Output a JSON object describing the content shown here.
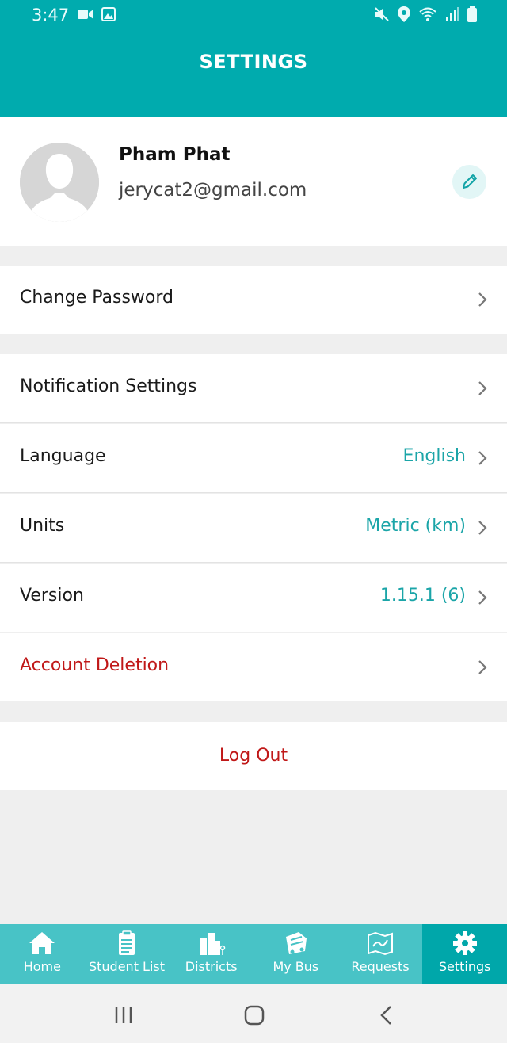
{
  "status_bar": {
    "time": "3:47"
  },
  "header": {
    "title": "SETTINGS"
  },
  "profile": {
    "name": "Pham Phat",
    "email": "jerycat2@gmail.com"
  },
  "settings": {
    "change_password": {
      "label": "Change Password"
    },
    "notification_settings": {
      "label": "Notification Settings"
    },
    "language": {
      "label": "Language",
      "value": "English"
    },
    "units": {
      "label": "Units",
      "value": "Metric (km)"
    },
    "version": {
      "label": "Version",
      "value": "1.15.1 (6)"
    },
    "account_deletion": {
      "label": "Account Deletion"
    }
  },
  "logout": {
    "label": "Log Out"
  },
  "tabs": [
    {
      "label": "Home",
      "icon": "home-icon"
    },
    {
      "label": "Student List",
      "icon": "clipboard-icon"
    },
    {
      "label": "Districts",
      "icon": "buildings-icon"
    },
    {
      "label": "My Bus",
      "icon": "bus-icon"
    },
    {
      "label": "Requests",
      "icon": "map-icon"
    },
    {
      "label": "Settings",
      "icon": "gear-icon",
      "active": true
    }
  ],
  "colors": {
    "primary": "#00abae",
    "tabbar": "#48c3c6",
    "accent_text": "#1ba5a8",
    "danger": "#c01818"
  }
}
